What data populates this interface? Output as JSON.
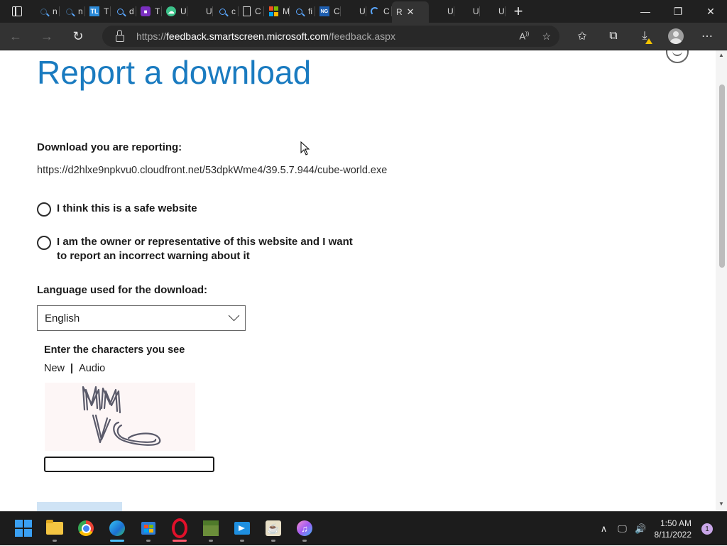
{
  "browser": {
    "tabs": [
      {
        "icon": "search-icon",
        "text": "n"
      },
      {
        "icon": "search-icon",
        "text": "n"
      },
      {
        "icon": "tl-icon",
        "text": "T"
      },
      {
        "icon": "search-icon",
        "text": "d"
      },
      {
        "icon": "lock-app-icon",
        "text": "T"
      },
      {
        "icon": "cloud-icon",
        "text": "U"
      },
      {
        "icon": "blank-icon",
        "text": "U"
      },
      {
        "icon": "search-icon",
        "text": "c"
      },
      {
        "icon": "page-icon",
        "text": "C"
      },
      {
        "icon": "microsoft-icon",
        "text": "M"
      },
      {
        "icon": "search-icon",
        "text": "fi"
      },
      {
        "icon": "ng-icon",
        "text": "C"
      },
      {
        "icon": "blank-icon",
        "text": "U"
      },
      {
        "icon": "loading-icon",
        "text": "C"
      },
      {
        "icon": "active",
        "text": "R"
      },
      {
        "icon": "blank-icon",
        "text": "U"
      },
      {
        "icon": "blank-icon",
        "text": "U"
      },
      {
        "icon": "blank-icon",
        "text": "U"
      }
    ],
    "url_prefix": "https://",
    "url_host": "feedback.smartscreen.microsoft.com",
    "url_path": "/feedback.aspx",
    "colors": {
      "tabstrip": "#202020",
      "toolbar": "#333333",
      "accent": "#1a7bc0"
    }
  },
  "page": {
    "title": "Report a download",
    "download_label": "Download you are reporting:",
    "download_url": "https://d2hlxe9npkvu0.cloudfront.net/53dpkWme4/39.5.7.944/cube-world.exe",
    "option_safe": "I think this is a safe website",
    "option_owner": "I am the owner or representative of this website and I want to report an incorrect warning about it",
    "language_label": "Language used for the download:",
    "language_value": "English",
    "captcha_title": "Enter the characters you see",
    "captcha_new": "New",
    "captcha_sep": "|",
    "captcha_audio": "Audio",
    "captcha_input_value": ""
  },
  "taskbar": {
    "apps": [
      "windows-start-icon",
      "file-explorer-icon",
      "chrome-icon",
      "edge-icon",
      "store-icon",
      "opera-icon",
      "minecraft-icon",
      "remote-app-icon",
      "java-icon",
      "itunes-icon"
    ],
    "time": "1:50 AM",
    "date": "8/11/2022",
    "notifications": "1"
  }
}
